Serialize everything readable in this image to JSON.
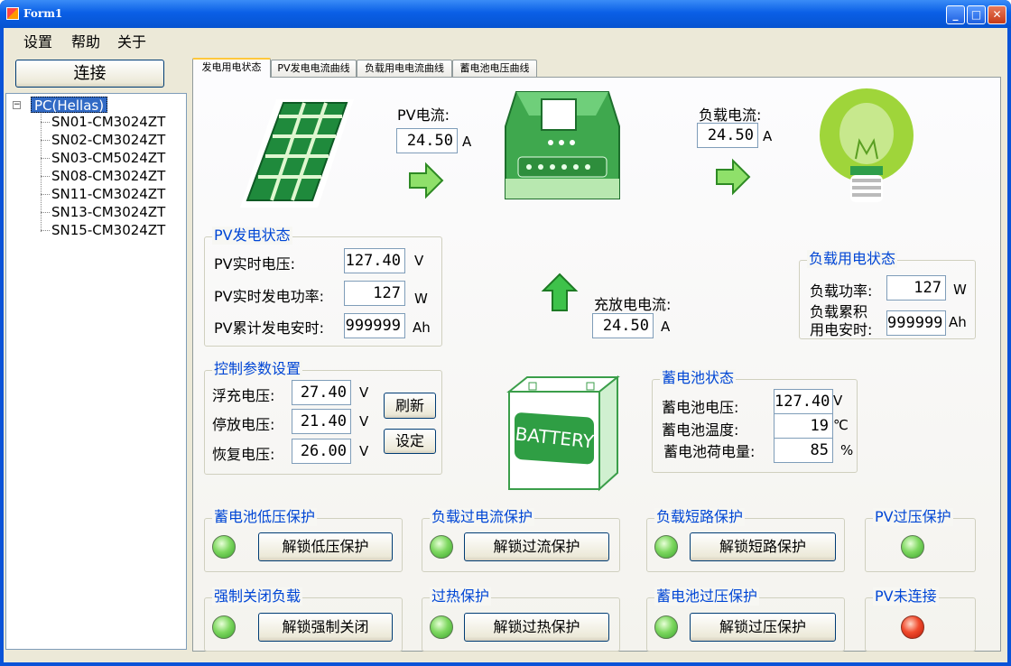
{
  "window": {
    "title": "Form1",
    "min": "_",
    "max": "□",
    "close": "✕"
  },
  "menu": {
    "settings": "设置",
    "help": "帮助",
    "about": "关于"
  },
  "connect_label": "连接",
  "tree": {
    "root": "PC(Hellas)",
    "expander": "−",
    "items": [
      "SN01-CM3024ZT",
      "SN02-CM3024ZT",
      "SN03-CM5024ZT",
      "SN08-CM3024ZT",
      "SN11-CM3024ZT",
      "SN13-CM3024ZT",
      "SN15-CM3024ZT"
    ]
  },
  "tabs": [
    "发电用电状态",
    "PV发电电流曲线",
    "负载用电电流曲线",
    "蓄电池电压曲线"
  ],
  "pv_current": {
    "label": "PV电流:",
    "value": "24.50",
    "unit": "A"
  },
  "load_current": {
    "label": "负载电流:",
    "value": "24.50",
    "unit": "A"
  },
  "charge_current": {
    "label": "充放电电流:",
    "value": "24.50",
    "unit": "A"
  },
  "pv_status": {
    "title": "PV发电状态",
    "voltage_label": "PV实时电压:",
    "voltage": "127.40",
    "voltage_unit": "V",
    "power_label": "PV实时发电功率:",
    "power": "127",
    "power_unit": "W",
    "ah_label": "PV累计发电安时:",
    "ah": "999999",
    "ah_unit": "Ah"
  },
  "load_status": {
    "title": "负载用电状态",
    "power_label": "负载功率:",
    "power": "127",
    "power_unit": "W",
    "ah_label1": "负载累积",
    "ah_label2": "用电安时:",
    "ah": "999999",
    "ah_unit": "Ah"
  },
  "control": {
    "title": "控制参数设置",
    "float_label": "浮充电压:",
    "float": "27.40",
    "float_unit": "V",
    "stop_label": "停放电压:",
    "stop": "21.40",
    "stop_unit": "V",
    "recover_label": "恢复电压:",
    "recover": "26.00",
    "recover_unit": "V",
    "refresh": "刷新",
    "set": "设定"
  },
  "battery_image_text": "BATTERY",
  "battery_status": {
    "title": "蓄电池状态",
    "voltage_label": "蓄电池电压:",
    "voltage": "127.40",
    "voltage_unit": "V",
    "temp_label": "蓄电池温度:",
    "temp": "19",
    "temp_unit": "℃",
    "charge_label": "蓄电池荷电量:",
    "charge": "85",
    "charge_unit": "%"
  },
  "protections": [
    {
      "title": "蓄电池低压保护",
      "button": "解锁低压保护",
      "led": "green"
    },
    {
      "title": "负载过电流保护",
      "button": "解锁过流保护",
      "led": "green"
    },
    {
      "title": "负载短路保护",
      "button": "解锁短路保护",
      "led": "green"
    },
    {
      "title": "PV过压保护",
      "led": "green"
    },
    {
      "title": "强制关闭负载",
      "button": "解锁强制关闭",
      "led": "green"
    },
    {
      "title": "过热保护",
      "button": "解锁过热保护",
      "led": "green"
    },
    {
      "title": "蓄电池过压保护",
      "button": "解锁过压保护",
      "led": "green"
    },
    {
      "title": "PV未连接",
      "led": "red"
    }
  ],
  "colors": {
    "accent": "#0046d5",
    "selection": "#316ac5",
    "green_icon": "#2e9e4a"
  }
}
